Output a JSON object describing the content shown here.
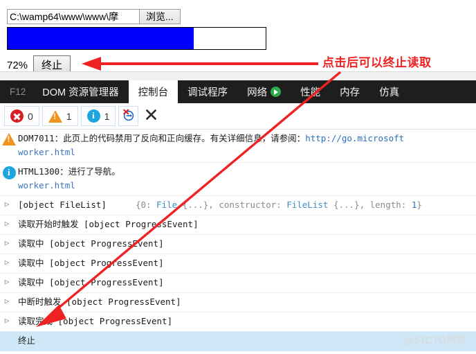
{
  "page": {
    "file_input": {
      "path_value": "C:\\wamp64\\www\\www\\摩",
      "browse_label": "浏览..."
    },
    "progress": {
      "percent": 72,
      "percent_label": "72%",
      "fill_color": "#0000ff",
      "track_color": "#ffffff"
    },
    "abort_button_label": "终止"
  },
  "annotations": {
    "callout_text": "点击后可以终止读取",
    "color": "#ee2222"
  },
  "devtools": {
    "tabs": [
      {
        "label": "F12",
        "icon": "",
        "active": false,
        "muted": true
      },
      {
        "label": "DOM 资源管理器",
        "icon": "",
        "active": false,
        "muted": false
      },
      {
        "label": "控制台",
        "icon": "",
        "active": true,
        "muted": false
      },
      {
        "label": "调试程序",
        "icon": "",
        "active": false,
        "muted": false
      },
      {
        "label": "网络",
        "icon": "play-icon",
        "active": false,
        "muted": false
      },
      {
        "label": "性能",
        "icon": "",
        "active": false,
        "muted": false
      },
      {
        "label": "内存",
        "icon": "",
        "active": false,
        "muted": false
      },
      {
        "label": "仿真",
        "icon": "",
        "active": false,
        "muted": false
      }
    ],
    "toolbar": {
      "error_count": "0",
      "warning_count": "1",
      "info_count": "1",
      "clear_on_navigate_icon": "clear-on-navigate-icon",
      "clear_console_icon": "clear-console-icon"
    },
    "console_messages": [
      {
        "level": "warning",
        "text": "DOM7011：此页上的代码禁用了反向和正向缓存。有关详细信息，请参阅：",
        "url": "http://go.microsoft",
        "source": "worker.html",
        "expandable": false,
        "selected": false
      },
      {
        "level": "info",
        "text": "HTML1300：进行了导航。",
        "url": "",
        "source": "worker.html",
        "expandable": false,
        "selected": false
      },
      {
        "level": "log",
        "text": "[object FileList]",
        "detail_prefix": "{0: ",
        "detail_type1": "File",
        "detail_mid": " {...}, constructor: ",
        "detail_type2": "FileList",
        "detail_mid2": " {...}, length: ",
        "detail_num": "1",
        "detail_suffix": "}",
        "expandable": true,
        "selected": false
      },
      {
        "level": "log",
        "text": "读取开始时触发 [object ProgressEvent]",
        "expandable": true,
        "selected": false
      },
      {
        "level": "log",
        "text": "读取中 [object ProgressEvent]",
        "expandable": true,
        "selected": false
      },
      {
        "level": "log",
        "text": "读取中 [object ProgressEvent]",
        "expandable": true,
        "selected": false
      },
      {
        "level": "log",
        "text": "读取中 [object ProgressEvent]",
        "expandable": true,
        "selected": false
      },
      {
        "level": "log",
        "text": "中断时触发 [object ProgressEvent]",
        "expandable": true,
        "selected": false
      },
      {
        "level": "log",
        "text": "读取完成 [object ProgressEvent]",
        "expandable": true,
        "selected": false
      },
      {
        "level": "log",
        "text": "终止",
        "expandable": false,
        "selected": true
      }
    ]
  },
  "watermark": "@51CTO博客"
}
